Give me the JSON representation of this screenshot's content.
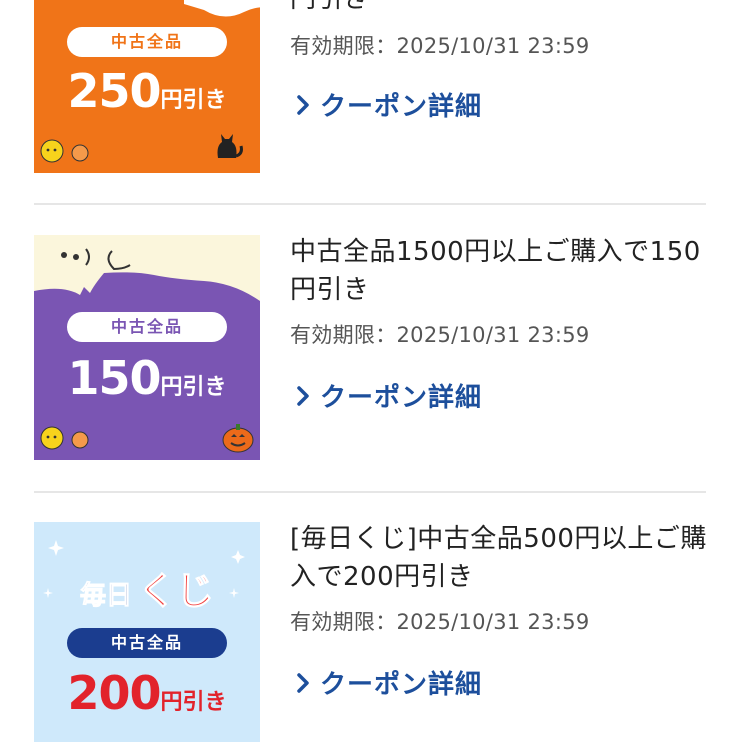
{
  "coupons": [
    {
      "title": "円引き",
      "expiry": "有効期限：2025/10/31 23:59",
      "link_label": "クーポン詳細",
      "banner": {
        "pill_label": "中古全品",
        "amount": "250",
        "amount_suffix": "円引き",
        "bg_color": "#f07418",
        "pill_text_color": "#f07418"
      }
    },
    {
      "title": "中古全品1500円以上ご購入で150円引き",
      "expiry": "有効期限：2025/10/31 23:59",
      "link_label": "クーポン詳細",
      "banner": {
        "pill_label": "中古全品",
        "amount": "150",
        "amount_suffix": "円引き",
        "bg_color": "#7a55b3",
        "top_color": "#fbf6dc",
        "pill_text_color": "#7a55b3"
      }
    },
    {
      "title": "[毎日くじ]中古全品500円以上ご購入で200円引き",
      "expiry": "有効期限：2025/10/31 23:59",
      "link_label": "クーポン詳細",
      "banner": {
        "heading_left": "毎日",
        "heading_right": "くじ",
        "pill_label": "中古全品",
        "amount": "200",
        "amount_suffix": "円引き",
        "bg_color": "#cfe9fb",
        "pill_bg": "#1b3d8f",
        "amount_color": "#e2232b"
      }
    }
  ],
  "colors": {
    "link": "#1d4f9c",
    "divider": "#e6e6e6",
    "title_text": "#222222",
    "expiry_text": "#555555"
  }
}
